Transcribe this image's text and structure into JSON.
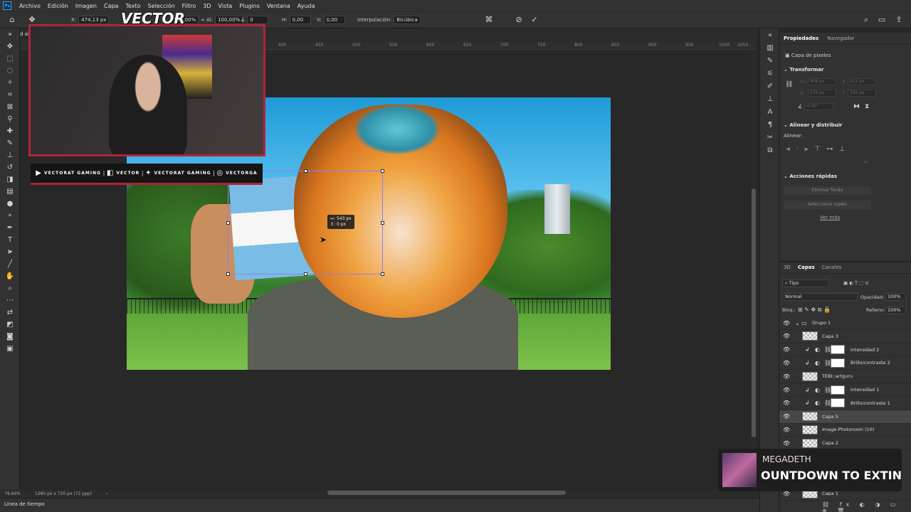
{
  "app": {
    "logo": "Ps"
  },
  "menu": [
    "Archivo",
    "Edición",
    "Imagen",
    "Capa",
    "Texto",
    "Selección",
    "Filtro",
    "3D",
    "Vista",
    "Plugins",
    "Ventana",
    "Ayuda"
  ],
  "options": {
    "x_label": "X:",
    "x_value": "474,13 px",
    "w_value": "100,00%",
    "h_label": "Al:",
    "h_value": "100,00%",
    "angle_value": "0",
    "hskew_label": "H:",
    "hskew_value": "0,00",
    "vskew_label": "V:",
    "vskew_value": "0,00",
    "interp_label": "Interpolación:",
    "interp_value": "Bicúbica"
  },
  "document": {
    "tab_title": "d al"
  },
  "ruler": [
    "400",
    "450",
    "500",
    "550",
    "600",
    "650",
    "700",
    "750",
    "800",
    "850",
    "900",
    "950",
    "1000",
    "1050"
  ],
  "canvas": {
    "measure_w": "↔: 543 px",
    "measure_h": "↕:    0 px"
  },
  "overlay": {
    "brand": "VECTOR",
    "socials": [
      {
        "icon": "youtube-icon",
        "glyph": "▶",
        "text": "VECTORAT GAMING"
      },
      {
        "icon": "twitch-icon",
        "glyph": "◧",
        "text": "VECTOR"
      },
      {
        "icon": "twitter-icon",
        "glyph": "✦",
        "text": "VECTORAT GAMING"
      },
      {
        "icon": "instagram-icon",
        "glyph": "◎",
        "text": "VECTORGA"
      }
    ]
  },
  "status": {
    "zoom": "79,66%",
    "doc_size": "1280 px x 720 px (72 ppp)"
  },
  "timeline": {
    "label": "Línea de tiempo"
  },
  "properties": {
    "tab_active": "Propiedades",
    "tab_other": "Navegador",
    "layer_type": "Capa de píxeles",
    "transform": "Transformar",
    "an_label": "An",
    "an_value": "408 px",
    "al_label": "Al",
    "al_value": "276 px",
    "x_label": "X",
    "x_value": "812 px",
    "y_label": "Y",
    "y_value": "192 px",
    "angle_value": "0,00°",
    "align_section": "Alinear y distribuir",
    "align_label": "Alinear:",
    "quick_section": "Acciones rápidas",
    "btn_remove_bg": "Eliminar fondo",
    "btn_select_subject": "Seleccionar sujeto",
    "see_more": "Ver más"
  },
  "layers_panel": {
    "tab_3d": "3D",
    "tab_layers": "Capas",
    "tab_channels": "Canales",
    "filter_kind": "Tipo",
    "blend_mode": "Normal",
    "opacity_label": "Opacidad:",
    "opacity_value": "100%",
    "lock_label": "Bloq.:",
    "fill_label": "Relleno:",
    "fill_value": "100%",
    "layers": [
      {
        "name": "Grupo 1",
        "kind": "group"
      },
      {
        "name": "Capa 3",
        "kind": "pixel"
      },
      {
        "name": "Intensidad 2",
        "kind": "adjustment"
      },
      {
        "name": "Brillo/contraste 2",
        "kind": "adjustment"
      },
      {
        "name": "TEBI::artguru",
        "kind": "pixel"
      },
      {
        "name": "Intensidad 1",
        "kind": "adjustment"
      },
      {
        "name": "Brillo/contraste 1",
        "kind": "adjustment"
      },
      {
        "name": "Capa 5",
        "kind": "pixel",
        "selected": true
      },
      {
        "name": "image-Photoroom (10)",
        "kind": "pixel"
      },
      {
        "name": "Capa 2",
        "kind": "pixel"
      }
    ],
    "bottom_layer": "Capa 1"
  },
  "music": {
    "artist": "MEGADETH",
    "song": "OUNTDOWN TO EXTIN"
  }
}
